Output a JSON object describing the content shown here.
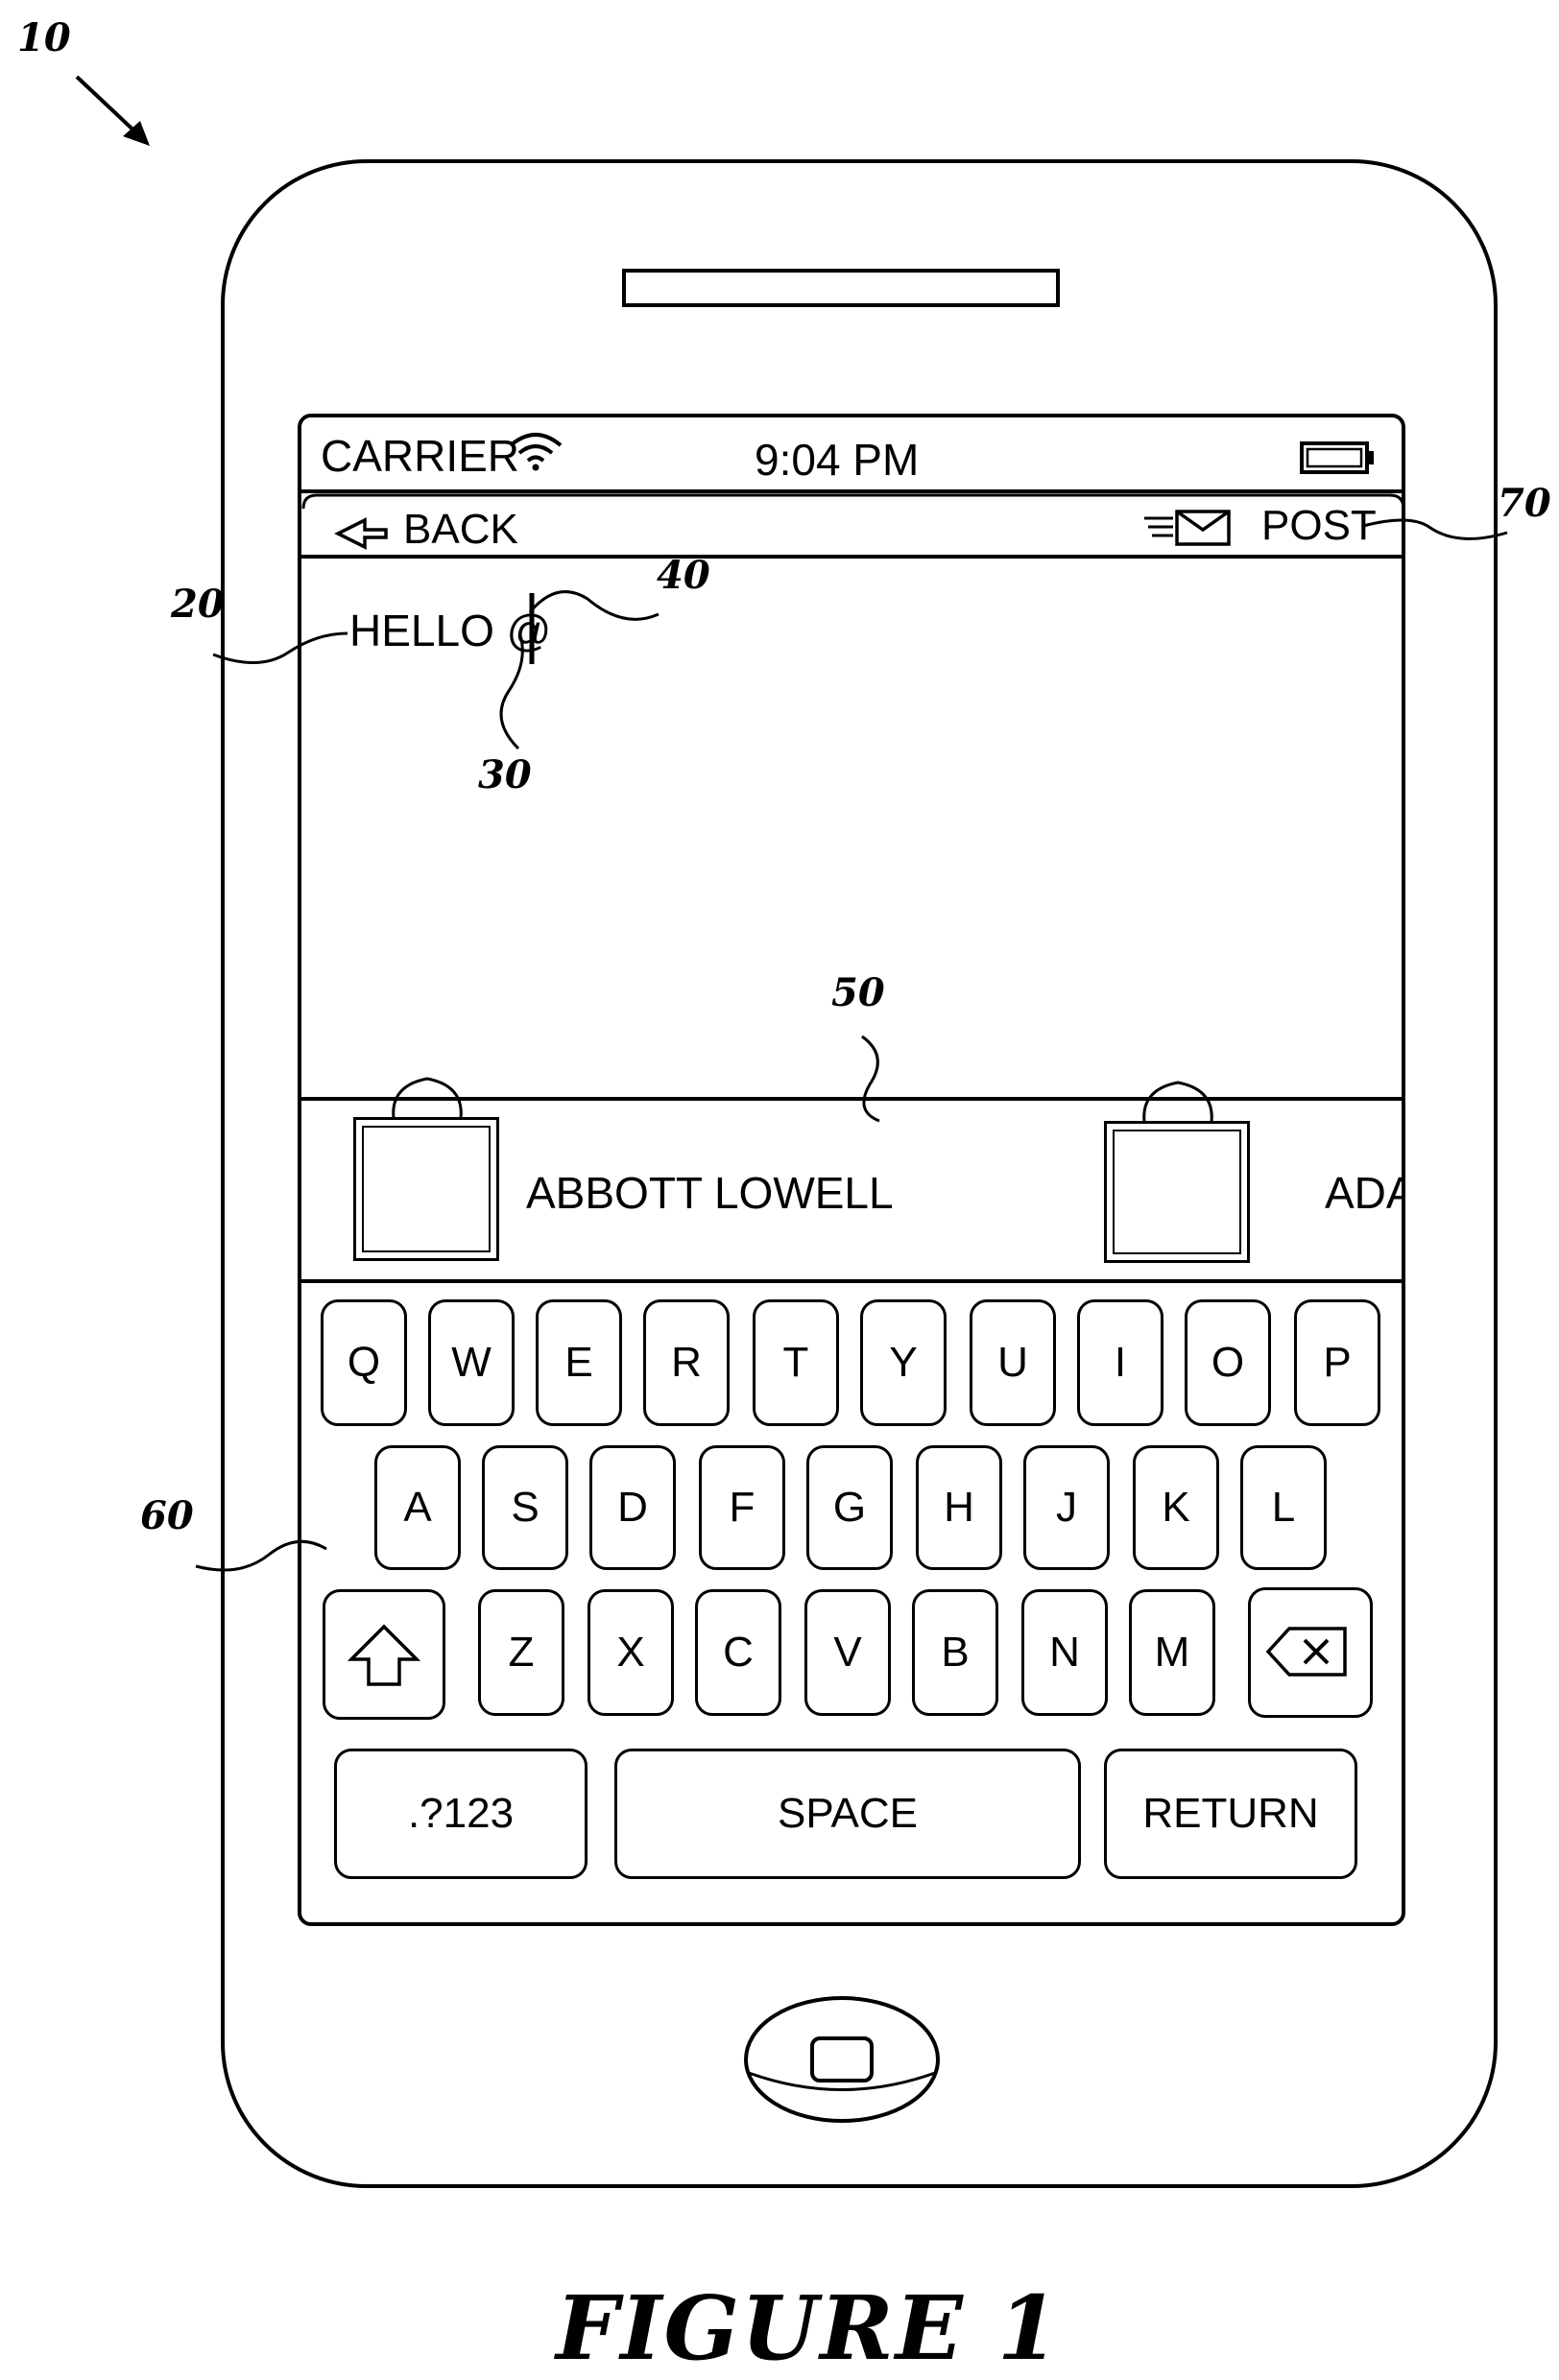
{
  "figure": {
    "caption": "FIGURE 1"
  },
  "reference_numerals": {
    "device": "10",
    "text_entry": "20",
    "cursor": "30",
    "trigger_char": "40",
    "suggestion_bar": "50",
    "keyboard": "60",
    "post_button": "70"
  },
  "status_bar": {
    "carrier": "CARRIER",
    "time": "9:04 PM",
    "wifi_icon": "wifi-icon",
    "battery_icon": "battery-icon"
  },
  "nav_bar": {
    "back_label": "BACK",
    "back_icon": "back-arrow-icon",
    "post_label": "POST",
    "post_icon": "envelope-send-icon"
  },
  "compose": {
    "text": "HELLO @"
  },
  "suggestions": [
    {
      "name": "ABBOTT  LOWELL",
      "avatar_icon": "person-silhouette-icon"
    },
    {
      "name": "ADA",
      "avatar_icon": "person-silhouette-icon"
    }
  ],
  "keyboard": {
    "row1": [
      "Q",
      "W",
      "E",
      "R",
      "T",
      "Y",
      "U",
      "I",
      "O",
      "P"
    ],
    "row2": [
      "A",
      "S",
      "D",
      "F",
      "G",
      "H",
      "J",
      "K",
      "L"
    ],
    "row3": [
      "Z",
      "X",
      "C",
      "V",
      "B",
      "N",
      "M"
    ],
    "shift_icon": "shift-arrow-icon",
    "backspace_icon": "backspace-icon",
    "numbers_label": ".?123",
    "space_label": "SPACE",
    "return_label": "RETURN"
  }
}
